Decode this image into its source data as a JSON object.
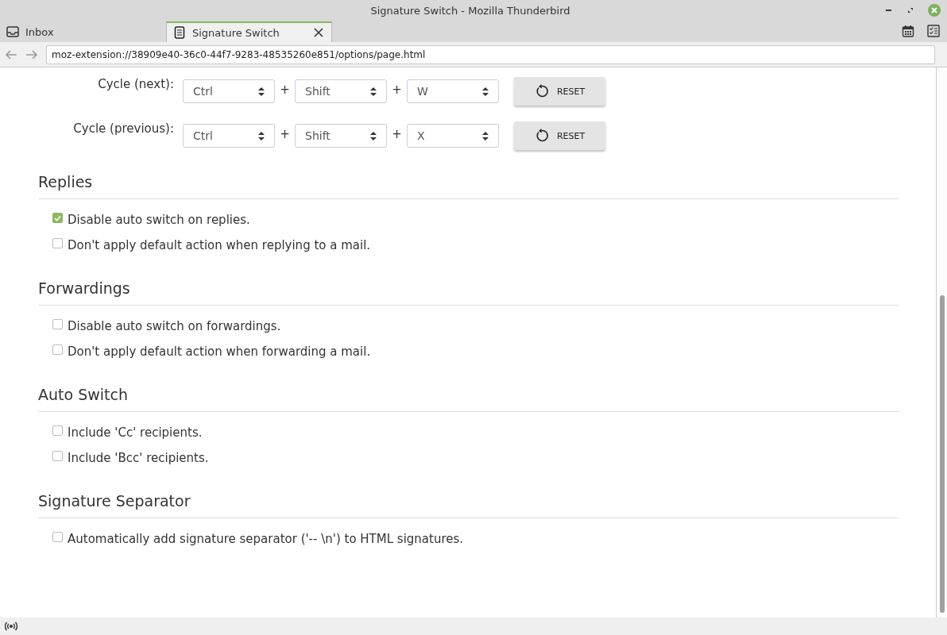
{
  "window": {
    "title": "Signature Switch - Mozilla Thunderbird"
  },
  "tabs": [
    {
      "label": "Inbox",
      "kind": "mail",
      "selected": false,
      "closable": false
    },
    {
      "label": "Signature Switch",
      "kind": "page",
      "selected": true,
      "closable": true
    }
  ],
  "address_bar": {
    "value": "moz-extension://38909e40-36c0-44f7-9283-48535260e851/options/page.html"
  },
  "shortcuts": [
    {
      "label": "Cycle (next):",
      "keys": [
        "Ctrl",
        "Shift",
        "W"
      ],
      "joiners": [
        "+",
        "+"
      ],
      "reset_label": "RESET"
    },
    {
      "label": "Cycle (previous):",
      "keys": [
        "Ctrl",
        "Shift",
        "X"
      ],
      "joiners": [
        "+",
        "+"
      ],
      "reset_label": "RESET"
    }
  ],
  "sections": [
    {
      "title": "Replies",
      "options": [
        {
          "label": "Disable auto switch on replies.",
          "checked": true
        },
        {
          "label": "Don't apply default action when replying to a mail.",
          "checked": false
        }
      ]
    },
    {
      "title": "Forwardings",
      "options": [
        {
          "label": "Disable auto switch on forwardings.",
          "checked": false
        },
        {
          "label": "Don't apply default action when forwarding a mail.",
          "checked": false
        }
      ]
    },
    {
      "title": "Auto Switch",
      "options": [
        {
          "label": "Include 'Cc' recipients.",
          "checked": false
        },
        {
          "label": "Include 'Bcc' recipients.",
          "checked": false
        }
      ]
    },
    {
      "title": "Signature Separator",
      "options": [
        {
          "label": "Automatically add signature separator ('-- \\n') to HTML signatures.",
          "checked": false
        }
      ]
    }
  ]
}
